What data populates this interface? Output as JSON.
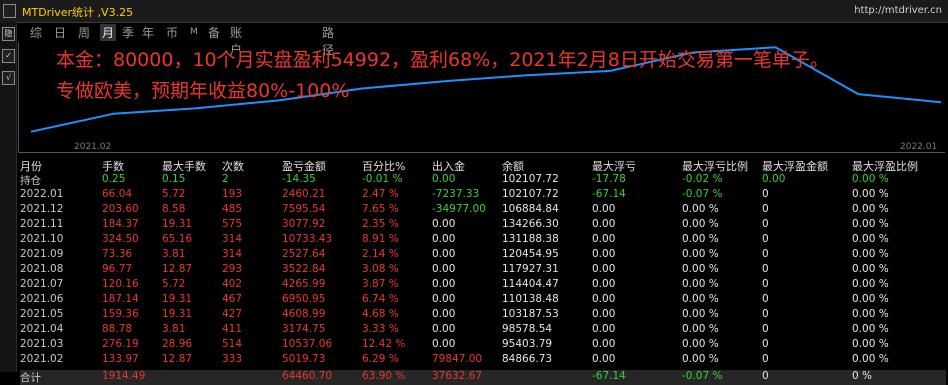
{
  "app": {
    "title": "MTDriver统计 ,V3.25",
    "url": "http://mtdriver.cn",
    "toolbar_glyphs": [
      "□",
      "隐",
      "✓",
      "√"
    ]
  },
  "tabs": [
    {
      "label": "综",
      "active": false,
      "small": false
    },
    {
      "label": "日",
      "active": false,
      "small": false
    },
    {
      "label": "周",
      "active": false,
      "small": false
    },
    {
      "label": "月",
      "active": true,
      "small": false
    },
    {
      "label": "季",
      "active": false,
      "small": false
    },
    {
      "label": "年",
      "active": false,
      "small": false
    },
    {
      "label": "币",
      "active": false,
      "small": false
    },
    {
      "label": "M",
      "active": false,
      "small": true
    },
    {
      "label": "备",
      "active": false,
      "small": false
    },
    {
      "label": "账户",
      "active": false,
      "small": false
    },
    {
      "label": "路径",
      "active": false,
      "small": false
    }
  ],
  "overlay": {
    "line1": "本金：80000，10个月实盘盈利54992，盈利68%，2021年2月8日开始交易第一笔单子。",
    "line2": "专做欧美，预期年收益80%-100%",
    "color": "#e8382d"
  },
  "chart_data": {
    "type": "line",
    "x": [
      "2021.02",
      "2021.03",
      "2021.04",
      "2021.05",
      "2021.06",
      "2021.07",
      "2021.08",
      "2021.09",
      "2021.10",
      "2021.11",
      "2021.12",
      "2022.01"
    ],
    "values": [
      84866.73,
      95403.79,
      98578.54,
      103187.53,
      110138.48,
      114404.47,
      117927.31,
      120454.95,
      131188.38,
      134266.3,
      106884.84,
      102107.72
    ],
    "x_ticks": [
      "2021.02",
      "2022.01"
    ],
    "line_color": "#1e90ff"
  },
  "table": {
    "headers": [
      "月份",
      "手数",
      "最大手数",
      "次数",
      "盈亏金额",
      "百分比%",
      "出入金",
      "余额",
      "最大浮亏",
      "最大浮亏比例",
      "最大浮盈金额",
      "最大浮盈比例"
    ],
    "position_row": [
      "持仓",
      "0.25",
      "0.15",
      "2",
      "-14.35",
      "-0.01 %",
      "0.00",
      "102107.72",
      "-17.78",
      "-0.02 %",
      "0.00",
      "0.00 %"
    ],
    "rows": [
      [
        "2022.01",
        "66.04",
        "5.72",
        "193",
        "2460.21",
        "2.47 %",
        "-7237.33",
        "102107.72",
        "-67.14",
        "-0.07 %",
        "0",
        "0.00 %"
      ],
      [
        "2021.12",
        "203.60",
        "8.58",
        "485",
        "7595.54",
        "7.65 %",
        "-34977.00",
        "106884.84",
        "0.00",
        "0.00 %",
        "0",
        "0.00 %"
      ],
      [
        "2021.11",
        "184.37",
        "19.31",
        "575",
        "3077.92",
        "2.35 %",
        "0.00",
        "134266.30",
        "0.00",
        "0.00 %",
        "0",
        "0.00 %"
      ],
      [
        "2021.10",
        "324.50",
        "65.16",
        "314",
        "10733.43",
        "8.91 %",
        "0.00",
        "131188.38",
        "0.00",
        "0.00 %",
        "0",
        "0.00 %"
      ],
      [
        "2021.09",
        "73.36",
        "3.81",
        "314",
        "2527.64",
        "2.14 %",
        "0.00",
        "120454.95",
        "0.00",
        "0.00 %",
        "0",
        "0.00 %"
      ],
      [
        "2021.08",
        "96.77",
        "12.87",
        "293",
        "3522.84",
        "3.08 %",
        "0.00",
        "117927.31",
        "0.00",
        "0.00 %",
        "0",
        "0.00 %"
      ],
      [
        "2021.07",
        "120.16",
        "5.72",
        "402",
        "4265.99",
        "3.87 %",
        "0.00",
        "114404.47",
        "0.00",
        "0.00 %",
        "0",
        "0.00 %"
      ],
      [
        "2021.06",
        "187.14",
        "19.31",
        "467",
        "6950.95",
        "6.74 %",
        "0.00",
        "110138.48",
        "0.00",
        "0.00 %",
        "0",
        "0.00 %"
      ],
      [
        "2021.05",
        "159.36",
        "19.31",
        "427",
        "4608.99",
        "4.68 %",
        "0.00",
        "103187.53",
        "0.00",
        "0.00 %",
        "0",
        "0.00 %"
      ],
      [
        "2021.04",
        "88.78",
        "3.81",
        "411",
        "3174.75",
        "3.33 %",
        "0.00",
        "98578.54",
        "0.00",
        "0.00 %",
        "0",
        "0.00 %"
      ],
      [
        "2021.03",
        "276.19",
        "28.96",
        "514",
        "10537.06",
        "12.42 %",
        "0.00",
        "95403.79",
        "0.00",
        "0.00 %",
        "0",
        "0.00 %"
      ],
      [
        "2021.02",
        "133.97",
        "12.87",
        "333",
        "5019.73",
        "6.29 %",
        "79847.00",
        "84866.73",
        "0.00",
        "0.00 %",
        "0",
        "0.00 %"
      ]
    ],
    "total_row": [
      "合计",
      "1914.49",
      "",
      "",
      "64460.70",
      "63.90 %",
      "37632.67",
      "",
      "-67.14",
      "-0.07 %",
      "0",
      "0 %"
    ]
  },
  "colors": {
    "header": "#e0e0e0",
    "month": "#c8c8c8",
    "red": "#e8382d",
    "green": "#35d435",
    "white": "#e6e6e6",
    "line": "#1e90ff"
  }
}
